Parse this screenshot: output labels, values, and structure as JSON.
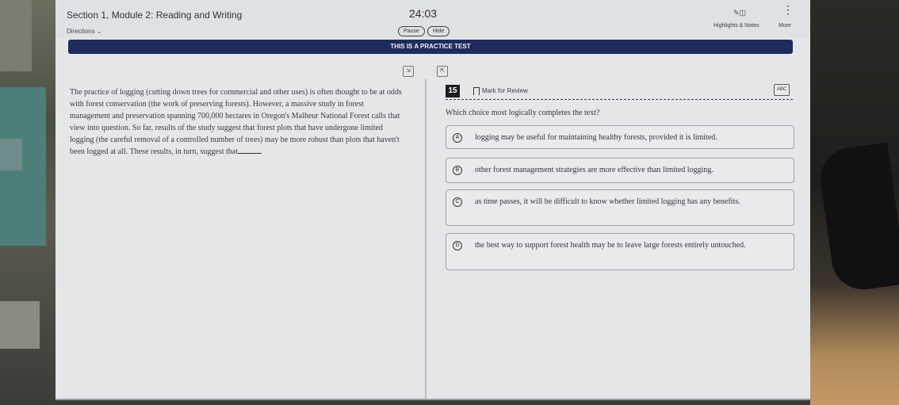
{
  "header": {
    "section_title": "Section 1, Module 2: Reading and Writing",
    "directions_label": "Directions",
    "timer": "24:03",
    "pause_label": "Pause",
    "hide_label": "Hide",
    "highlights_label": "Highlights & Notes",
    "more_label": "More"
  },
  "banner": {
    "text": "THIS IS A PRACTICE TEST"
  },
  "passage": {
    "text": "The practice of logging (cutting down trees for commercial and other uses) is often thought to be at odds with forest conservation (the work of preserving forests). However, a massive study in forest management and preservation spanning 700,000 hectares in Oregon's Malheur National Forest calls that view into question. So far, results of the study suggest that forest plots that have undergone limited logging (the careful removal of a controlled number of trees) may be more robust than plots that haven't been logged at all. These results, in turn, suggest that"
  },
  "question": {
    "number": "15",
    "mark_for_review": "Mark for Review",
    "abc_label": "ABC",
    "stem": "Which choice most logically completes the text?",
    "choices": [
      {
        "letter": "A",
        "text": "logging may be useful for maintaining healthy forests, provided it is limited."
      },
      {
        "letter": "B",
        "text": "other forest management strategies are more effective than limited logging."
      },
      {
        "letter": "C",
        "text": "as time passes, it will be difficult to know whether limited logging has any benefits."
      },
      {
        "letter": "D",
        "text": "the best way to support forest health may be to leave large forests entirely untouched."
      }
    ]
  },
  "colors": {
    "banner_bg": "#1f2b5c",
    "question_number_bg": "#1b1d21",
    "screen_bg": "#e4e6e8"
  },
  "icons": {
    "directions_chevron": "chevron-down-icon",
    "highlight": "pencil-icon",
    "notes": "notes-icon",
    "more": "vertical-dots-icon",
    "expand_left": "expand-icon",
    "expand_right": "collapse-icon",
    "bookmark": "bookmark-icon",
    "eliminator": "abc-strikethrough-icon"
  }
}
